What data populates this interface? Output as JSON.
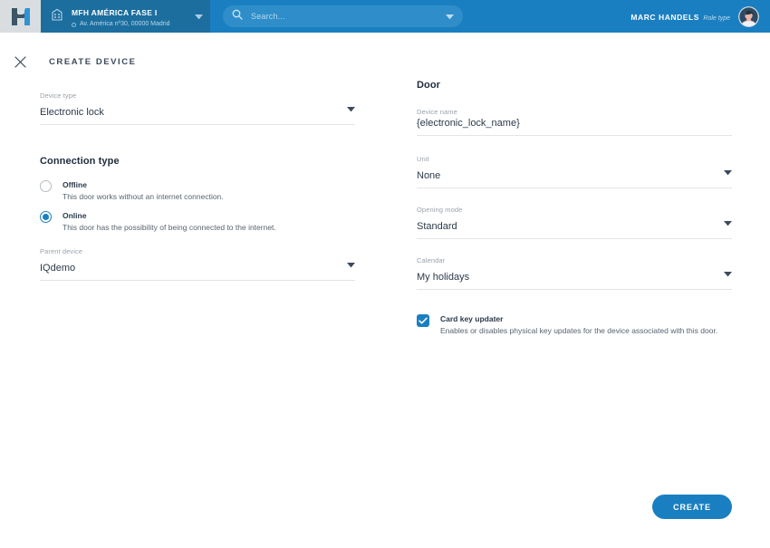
{
  "header": {
    "logo_icon": "h-logo-icon",
    "site": {
      "icon": "building-icon",
      "name": "MFH AMÉRICA FASE I",
      "address": "Av. América nº30, 00000 Madrid",
      "caret_icon": "chevron-down-icon"
    },
    "search": {
      "icon": "search-icon",
      "placeholder": "Search...",
      "value": "",
      "caret_icon": "chevron-down-icon"
    },
    "user": {
      "name": "MARC HANDELS",
      "role": "Role type",
      "avatar_icon": "avatar"
    }
  },
  "page": {
    "close_icon": "close-icon",
    "title": "CREATE DEVICE"
  },
  "left": {
    "device_type": {
      "label": "Device type",
      "value": "Electronic lock",
      "caret_icon": "chevron-down-icon"
    },
    "connection_type": {
      "title": "Connection type",
      "options": [
        {
          "label": "Offline",
          "description": "This door works without an internet connection.",
          "selected": false
        },
        {
          "label": "Online",
          "description": "This door has the possibility of being connected to the internet.",
          "selected": true
        }
      ]
    },
    "parent_device": {
      "label": "Parent device",
      "value": "IQdemo",
      "caret_icon": "chevron-down-icon"
    }
  },
  "right": {
    "section_title": "Door",
    "device_name": {
      "label": "Device name",
      "value": "{electronic_lock_name}"
    },
    "unit": {
      "label": "Unit",
      "value": "None",
      "caret_icon": "chevron-down-icon"
    },
    "opening_mode": {
      "label": "Opening mode",
      "value": "Standard",
      "caret_icon": "chevron-down-icon"
    },
    "calendar": {
      "label": "Calendar",
      "value": "My holidays",
      "caret_icon": "chevron-down-icon"
    },
    "card_key_updater": {
      "label": "Card key updater",
      "description": "Enables or disables physical key updates for the device associated with this door.",
      "checked": true,
      "check_icon": "check-icon"
    }
  },
  "footer": {
    "create_label": "CREATE"
  },
  "colors": {
    "brand_blue": "#1a7fc1",
    "header_dark": "#1c6e9e",
    "logo_bg": "#d9dde0",
    "text_dark": "#2b3a4a",
    "label_gray": "#9aa3ad"
  }
}
